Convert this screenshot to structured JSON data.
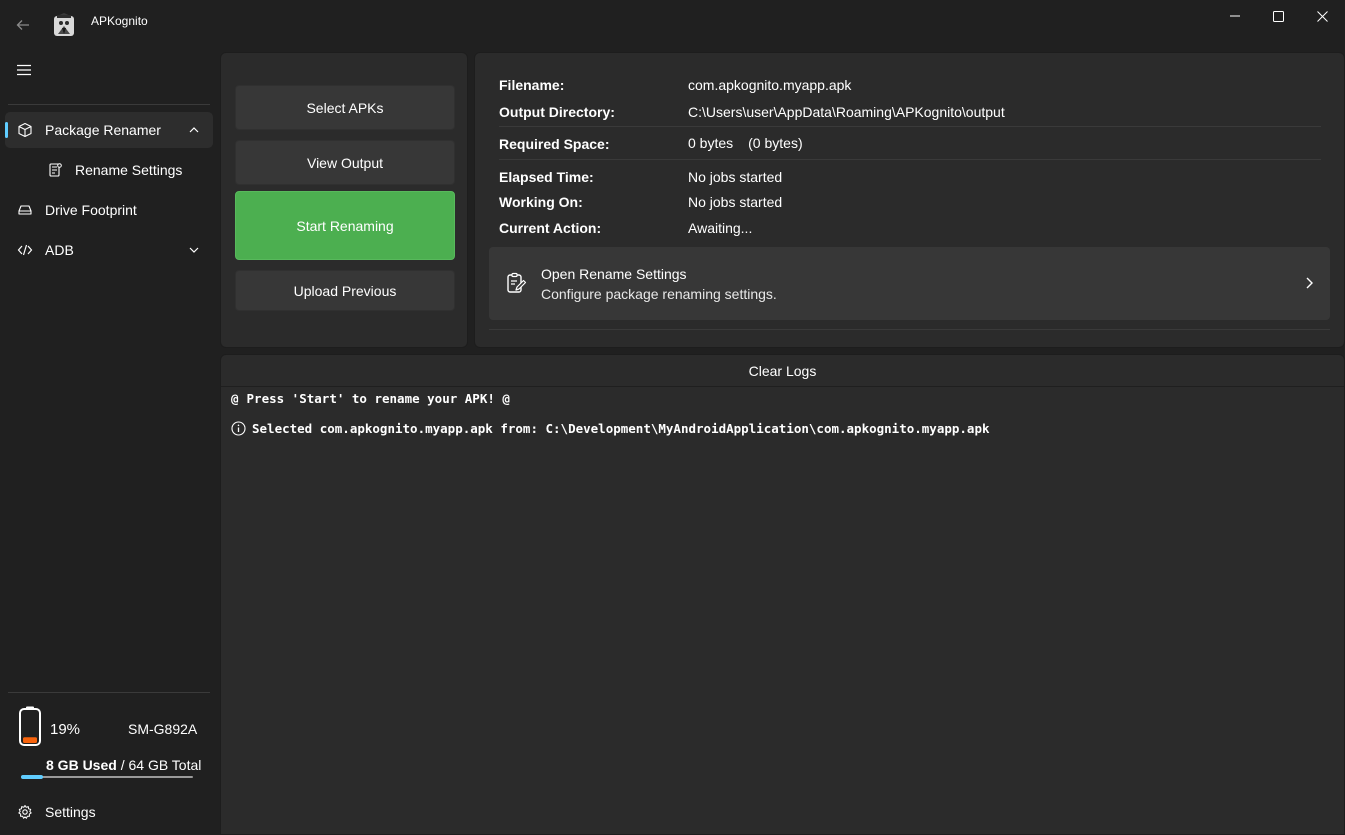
{
  "window": {
    "title": "APKognito"
  },
  "sidebar": {
    "items": [
      {
        "label": "Package Renamer",
        "icon": "package-icon"
      },
      {
        "label": "Rename Settings",
        "icon": "settings-document-icon"
      },
      {
        "label": "Drive Footprint",
        "icon": "drive-icon"
      },
      {
        "label": "ADB",
        "icon": "code-icon"
      }
    ],
    "footer": {
      "label": "Settings",
      "icon": "gear-icon"
    }
  },
  "device": {
    "battery_percent_label": "19%",
    "battery_level": 0.19,
    "name": "SM-G892A",
    "storage_used": "8 GB Used",
    "storage_separator": " / ",
    "storage_total": "64 GB Total",
    "storage_fraction": 0.125
  },
  "actions": {
    "select": "Select APKs",
    "view_output": "View Output",
    "start": "Start Renaming",
    "upload": "Upload Previous"
  },
  "info": {
    "filename_label": "Filename:",
    "filename": "com.apkognito.myapp.apk",
    "output_dir_label": "Output Directory:",
    "output_dir": "C:\\Users\\user\\AppData\\Roaming\\APKognito\\output",
    "required_space_label": "Required Space:",
    "required_space": "0 bytes",
    "required_space_exact": "(0 bytes)",
    "elapsed_label": "Elapsed Time:",
    "elapsed": "No jobs started",
    "working_on_label": "Working On:",
    "working_on": "No jobs started",
    "current_action_label": "Current Action:",
    "current_action": "Awaiting..."
  },
  "settings_card": {
    "title": "Open Rename Settings",
    "description": "Configure package renaming settings."
  },
  "logs": {
    "clear_label": "Clear Logs",
    "lines": [
      {
        "prefix": "@",
        "text": "Press 'Start' to rename your APK! @"
      },
      {
        "prefix": "info-icon",
        "text": "Selected com.apkognito.myapp.apk from: C:\\Development\\MyAndroidApplication\\com.apkognito.myapp.apk"
      }
    ]
  },
  "colors": {
    "accent_green": "#4caf50",
    "accent_blue": "#60cdff",
    "battery_low": "#f7630c"
  }
}
